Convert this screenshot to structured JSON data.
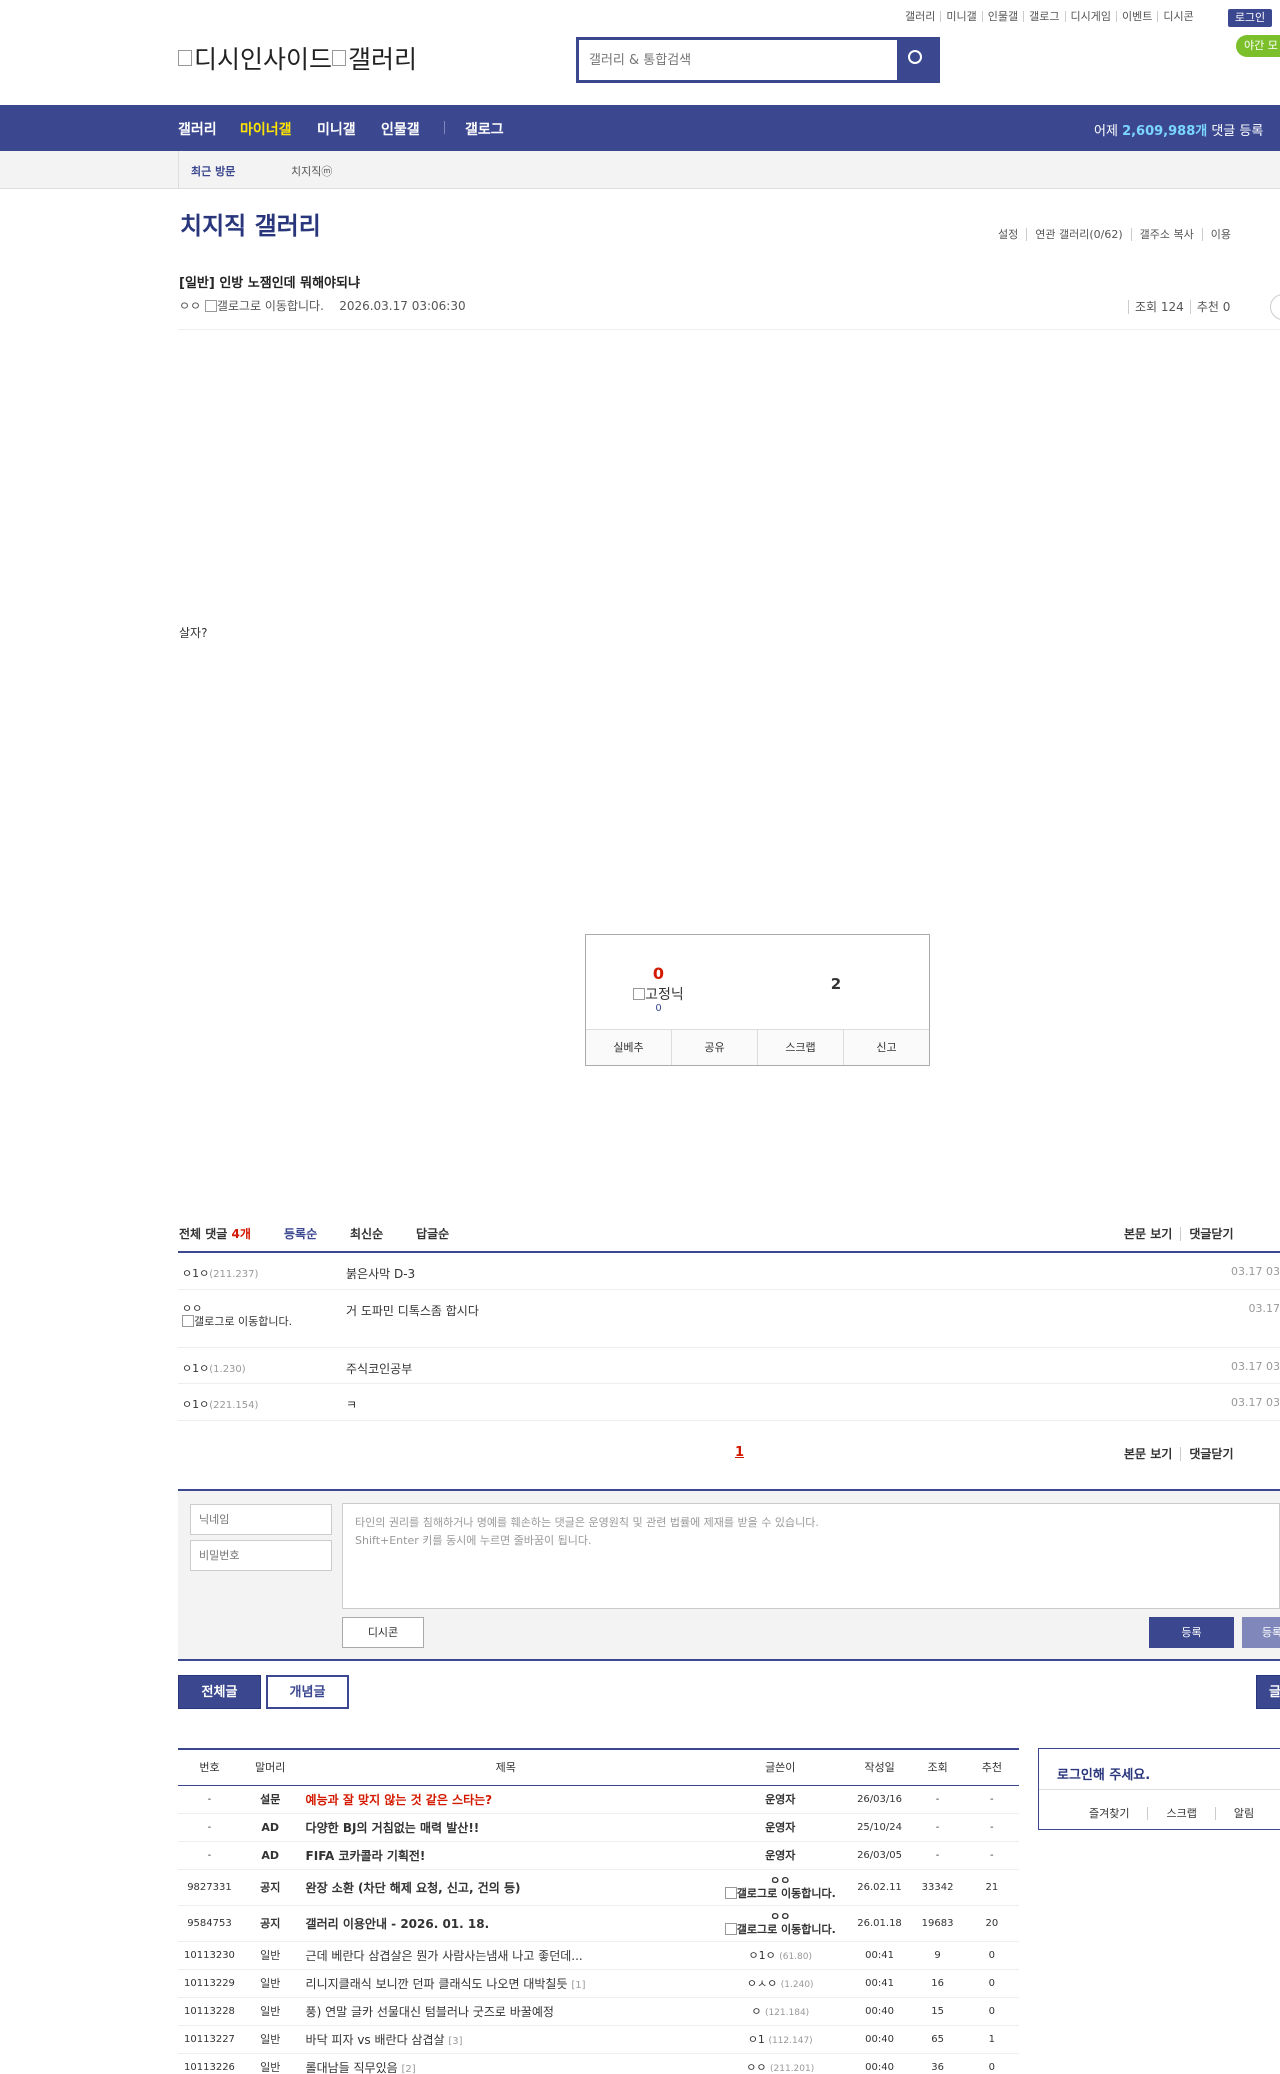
{
  "util_menu": [
    "갤러리",
    "미니갤",
    "인물갤",
    "갤로그",
    "디시게임",
    "이벤트",
    "디시콘"
  ],
  "login_label": "로그인",
  "night_label": "야간 모",
  "logo_alt_1": "디시인사이드",
  "logo_alt_2": "갤러리",
  "search": {
    "placeholder": "갤러리 & 통합검색"
  },
  "nav": {
    "items": [
      "갤러리",
      "마이너갤",
      "미니갤",
      "인물갤",
      "갤로그"
    ],
    "stats_prefix": "어제 ",
    "stats_value": "2,609,988개",
    "stats_suffix": " 댓글 등록"
  },
  "visit": {
    "title": "최근 방문",
    "item": "치지직ⓜ"
  },
  "gallery": {
    "title": "치지직 갤러리",
    "tools": [
      "설정",
      "연관 갤러리(0/62)",
      "갤주소 복사",
      "이용"
    ]
  },
  "post": {
    "title": "[일반] 인방 노잼인데 뭐해야되냐",
    "author": "ㅇㅇ",
    "author_img_alt": "갤로그로 이동합니다.",
    "date": "2026.03.17 03:06:30",
    "views": "조회 124",
    "recommends": "추천 0",
    "body": "살자?"
  },
  "recommend": {
    "up_count": "0",
    "fix_label": "고정닉",
    "fix_count": "0",
    "down_count": "2",
    "buttons": [
      "실베추",
      "공유",
      "스크랩",
      "신고"
    ]
  },
  "comments": {
    "total_label": "전체 댓글 ",
    "total_count": "4개",
    "sort": [
      "등록순",
      "최신순",
      "답글순"
    ],
    "right_links": [
      "본문 보기",
      "댓글닫기"
    ],
    "items": [
      {
        "nick": "ㅇ1ㅇ",
        "ip": "(211.237)",
        "text": "붉은사막 D-3",
        "date": "03.17 03"
      },
      {
        "nick": "ㅇㅇ",
        "img_alt": "갤로그로 이동합니다.",
        "text": "거 도파민 디톡스좀 합시다",
        "date": "03.17"
      },
      {
        "nick": "ㅇ1ㅇ",
        "ip": "(1.230)",
        "text": "주식코인공부",
        "date": "03.17 03"
      },
      {
        "nick": "ㅇ1ㅇ",
        "ip": "(221.154)",
        "text": "ㅋ",
        "date": "03.17 03"
      }
    ],
    "page": "1"
  },
  "write": {
    "nick_placeholder": "닉네임",
    "pw_placeholder": "비밀번호",
    "notice_line1": "타인의 권리를 침해하거나 명예를 훼손하는 댓글은 운영원칙 및 관련 법률에 제재를 받을 수 있습니다.",
    "notice_line2": "Shift+Enter 키를 동시에 누르면 줄바꿈이 됩니다.",
    "dccon": "디시콘",
    "submit": "등록",
    "submit2": "등록"
  },
  "list_tabs": {
    "all": "전체글",
    "concept": "개념글",
    "write": "글"
  },
  "list": {
    "headers": [
      "번호",
      "말머리",
      "제목",
      "글쓴이",
      "작성일",
      "조회",
      "추천"
    ],
    "rows": [
      {
        "num": "-",
        "head": "설문",
        "title": "예능과 잘 맞지 않는 것 같은 스타는?",
        "writer": "운영자",
        "date": "26/03/16",
        "view": "-",
        "rec": "-",
        "red": true,
        "notice": true
      },
      {
        "num": "-",
        "head": "AD",
        "title": "다양한 BJ의 거침없는 매력 발산!!",
        "writer": "운영자",
        "date": "25/10/24",
        "view": "-",
        "rec": "-",
        "notice": true
      },
      {
        "num": "-",
        "head": "AD",
        "title": "FIFA 코카콜라 기획전!",
        "writer": "운영자",
        "date": "26/03/05",
        "view": "-",
        "rec": "-",
        "notice": true
      },
      {
        "num": "9827331",
        "head": "공지",
        "title": "완장 소환 (차단 해제 요청, 신고, 건의 등)",
        "writer": "ㅇㅇ",
        "writer_alt": "갤로그로 이동합니다.",
        "date": "26.02.11",
        "view": "33342",
        "rec": "21",
        "notice": true
      },
      {
        "num": "9584753",
        "head": "공지",
        "title": "갤러리 이용안내 - 2026. 01. 18.",
        "writer": "ㅇㅇ",
        "writer_alt": "갤로그로 이동합니다.",
        "date": "26.01.18",
        "view": "19683",
        "rec": "20",
        "notice": true
      },
      {
        "num": "10113230",
        "head": "일반",
        "title": "근데 베란다 삼겹살은 뭔가 사람사는냄새 나고 좋던데...",
        "writer": "ㅇ1ㅇ",
        "ip": "(61.80)",
        "date": "00:41",
        "view": "9",
        "rec": "0"
      },
      {
        "num": "10113229",
        "head": "일반",
        "title": "리니지클래식 보니깐 던파 클래식도 나오면 대박칠듯",
        "reply": "[1]",
        "writer": "ㅇㅅㅇ",
        "ip": "(1.240)",
        "date": "00:41",
        "view": "16",
        "rec": "0"
      },
      {
        "num": "10113228",
        "head": "일반",
        "title": "풍) 연말 글카 선물대신 텀블러나 굿즈로 바꿀예정",
        "writer": "ㅇ",
        "ip": "(121.184)",
        "date": "00:40",
        "view": "15",
        "rec": "0"
      },
      {
        "num": "10113227",
        "head": "일반",
        "title": "바닥 피자 vs 배란다 삼겹살",
        "reply": "[3]",
        "writer": "ㅇ1",
        "ip": "(112.147)",
        "date": "00:40",
        "view": "65",
        "rec": "1"
      },
      {
        "num": "10113226",
        "head": "일반",
        "title": "롤대남들 직무있음",
        "reply": "[2]",
        "writer": "ㅇㅇ",
        "ip": "(211.201)",
        "date": "00:40",
        "view": "36",
        "rec": "0"
      }
    ]
  },
  "login_box": {
    "title": "로그인해 주세요.",
    "links": [
      "즐겨찾기",
      "스크랩",
      "알림"
    ]
  }
}
